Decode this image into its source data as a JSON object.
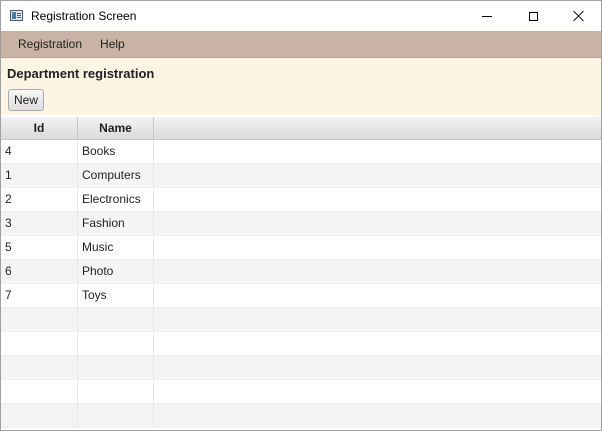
{
  "window": {
    "title": "Registration Screen",
    "icon": "app-window-icon"
  },
  "menubar": {
    "items": [
      {
        "label": "Registration"
      },
      {
        "label": "Help"
      }
    ]
  },
  "header": {
    "title": "Department registration",
    "new_label": "New"
  },
  "table": {
    "columns": [
      "Id",
      "Name"
    ],
    "rows": [
      {
        "id": "4",
        "name": "Books"
      },
      {
        "id": "1",
        "name": "Computers"
      },
      {
        "id": "2",
        "name": "Electronics"
      },
      {
        "id": "3",
        "name": "Fashion"
      },
      {
        "id": "5",
        "name": "Music"
      },
      {
        "id": "6",
        "name": "Photo"
      },
      {
        "id": "7",
        "name": "Toys"
      }
    ],
    "empty_rows": 5
  },
  "colors": {
    "menubar_bg": "#c9b3a4",
    "header_bg": "#fdf5e4",
    "row_alt": "#f4f4f4"
  }
}
